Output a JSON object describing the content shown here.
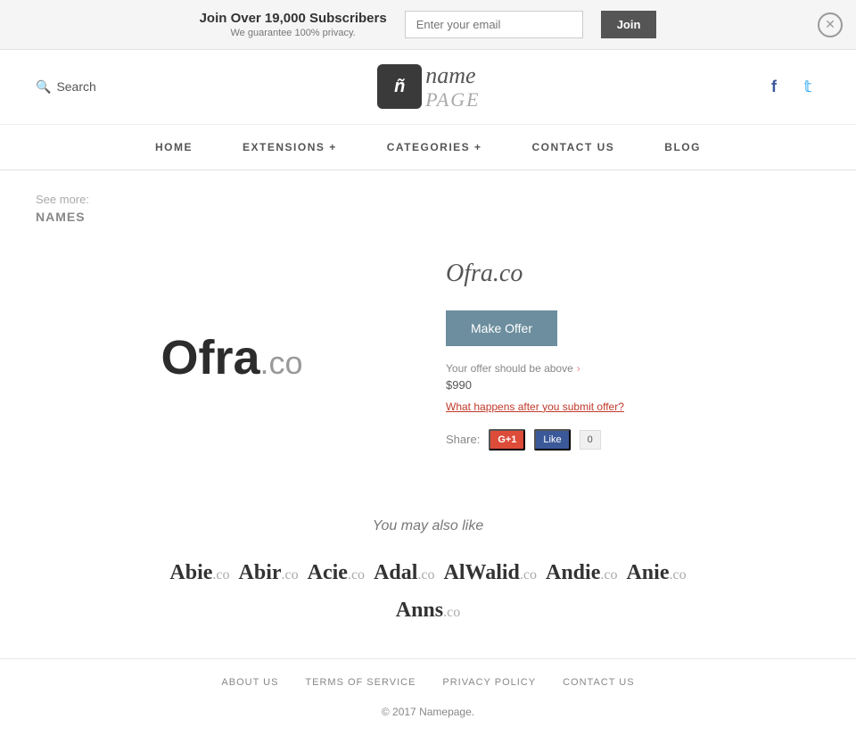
{
  "banner": {
    "title": "Join Over 19,000 Subscribers",
    "subtitle": "We guarantee 100% privacy.",
    "email_placeholder": "Enter your email",
    "join_label": "Join"
  },
  "header": {
    "search_label": "Search",
    "logo_icon": "ñ",
    "logo_name_line": "name",
    "logo_page_line": "PAGE",
    "social": [
      {
        "name": "facebook",
        "icon": "f"
      },
      {
        "name": "twitter",
        "icon": "t"
      }
    ]
  },
  "nav": {
    "items": [
      {
        "label": "HOME",
        "id": "home"
      },
      {
        "label": "EXTENSIONS +",
        "id": "extensions"
      },
      {
        "label": "CATEGORIES +",
        "id": "categories"
      },
      {
        "label": "CONTACT US",
        "id": "contact"
      },
      {
        "label": "BLOG",
        "id": "blog"
      }
    ]
  },
  "breadcrumb": {
    "see_more": "See more:",
    "category": "NAMES"
  },
  "domain": {
    "display_name": "Ofra",
    "tld": ".co",
    "full": "Ofra.co",
    "make_offer_label": "Make Offer",
    "offer_hint": "Your offer should be above",
    "min_price": "$990",
    "what_happens_label": "What happens after you submit offer?",
    "share_label": "Share:",
    "g1_label": "G+1",
    "fb_label": "Like",
    "fb_count": "0"
  },
  "similar": {
    "title": "You may also like",
    "items": [
      {
        "name": "Abie",
        "tld": ".co"
      },
      {
        "name": "Abir",
        "tld": ".co"
      },
      {
        "name": "Acie",
        "tld": ".co"
      },
      {
        "name": "Adal",
        "tld": ".co"
      },
      {
        "name": "AlWalid",
        "tld": ".co"
      },
      {
        "name": "Andie",
        "tld": ".co"
      },
      {
        "name": "Anie",
        "tld": ".co"
      },
      {
        "name": "Anns",
        "tld": ".co"
      }
    ]
  },
  "footer": {
    "links": [
      {
        "label": "ABOUT US",
        "id": "about"
      },
      {
        "label": "TERMS OF SERVICE",
        "id": "terms"
      },
      {
        "label": "PRIVACY POLICY",
        "id": "privacy"
      },
      {
        "label": "CONTACT US",
        "id": "contact"
      }
    ],
    "copy_prefix": "© 2017 ",
    "copy_brand": "Namepage."
  }
}
